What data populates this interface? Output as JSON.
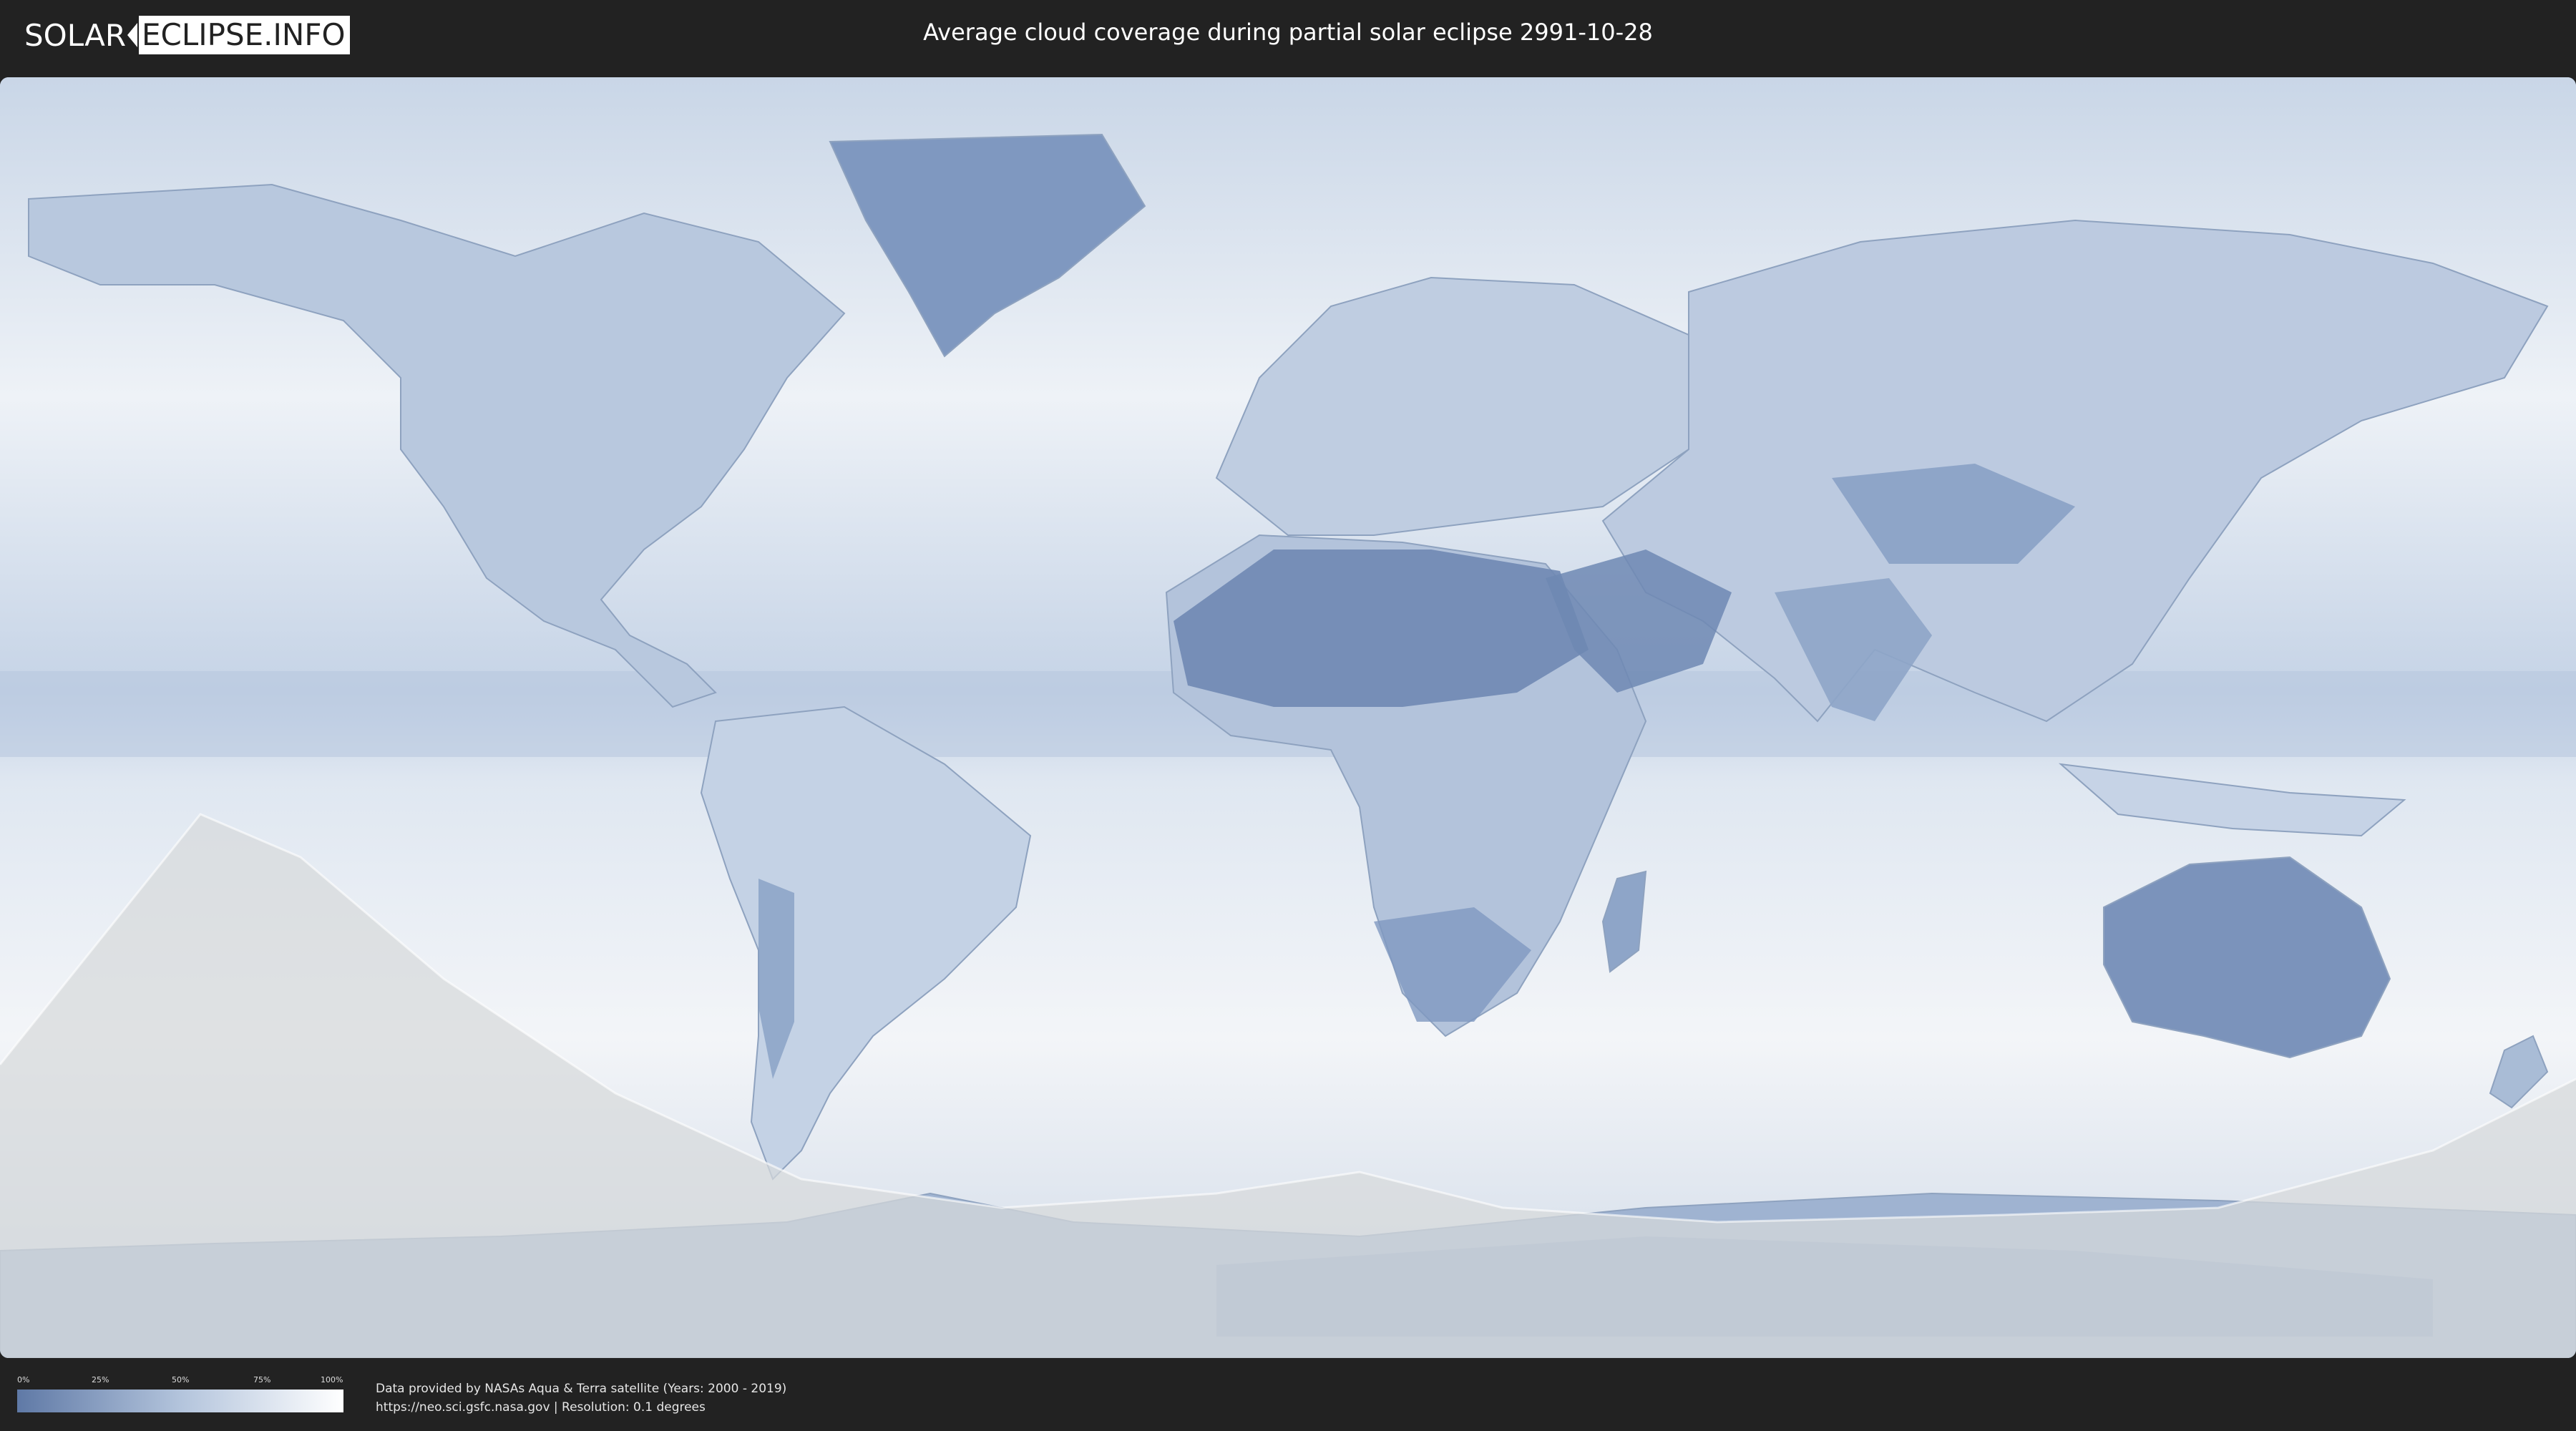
{
  "header": {
    "logo_left": "SOLAR",
    "logo_right": "ECLIPSE.INFO",
    "title": "Average cloud coverage during partial solar eclipse 2991-10-28"
  },
  "legend": {
    "ticks": [
      "0%",
      "25%",
      "50%",
      "75%",
      "100%"
    ],
    "fractions": [
      0.0,
      0.25,
      0.5,
      0.75,
      1.0
    ],
    "color_low": "#5f79a6",
    "color_high": "#ffffff"
  },
  "credits": {
    "line1": "Data provided by NASAs Aqua & Terra satellite (Years: 2000 - 2019)",
    "line2": "https://neo.sci.gsfc.nasa.gov | Resolution: 0.1 degrees"
  },
  "map": {
    "projection": "equirectangular",
    "ocean_color": "#e9eef5",
    "land_color": "#a9bcd6",
    "dry_region_color": "#6f88b3",
    "shadow_zone_color": "#d7d9db"
  }
}
